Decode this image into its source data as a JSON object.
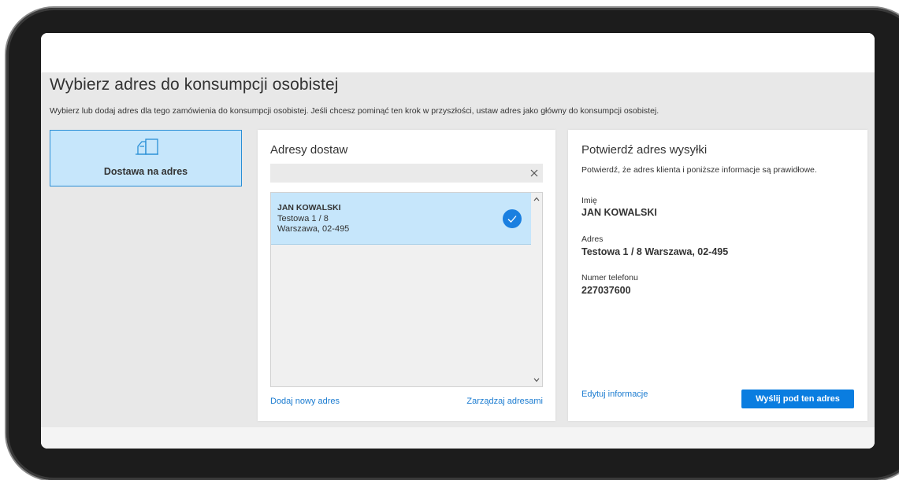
{
  "page": {
    "title": "Wybierz adres do konsumpcji osobistej",
    "description": "Wybierz lub dodaj adres dla tego zamówienia do konsumpcji osobistej. Jeśli chcesz pominąć ten krok w przyszłości, ustaw adres jako główny do konsumpcji osobistej."
  },
  "delivery_option": {
    "label": "Dostawa na adres",
    "icon": "delivery-truck-icon"
  },
  "addresses_panel": {
    "title": "Adresy dostaw",
    "search_value": "",
    "items": [
      {
        "name": "JAN KOWALSKI",
        "line1": "Testowa 1 / 8",
        "line2": "Warszawa, 02-495",
        "selected": true
      }
    ],
    "add_link": "Dodaj nowy adres",
    "manage_link": "Zarządzaj adresami"
  },
  "confirm_panel": {
    "title": "Potwierdź adres wysyłki",
    "description": "Potwierdź, że adres klienta i poniższe informacje są prawidłowe.",
    "name_label": "Imię",
    "name_value": "JAN KOWALSKI",
    "address_label": "Adres",
    "address_value": "Testowa 1 / 8 Warszawa, 02-495",
    "phone_label": "Numer telefonu",
    "phone_value": "227037600",
    "edit_link": "Edytuj informacje",
    "send_button": "Wyślij pod ten adres"
  },
  "colors": {
    "accent": "#0a7de0",
    "selected_bg": "#c6e6fb",
    "content_bg": "#e8e8e8",
    "device_frame": "#1c1c1c"
  }
}
